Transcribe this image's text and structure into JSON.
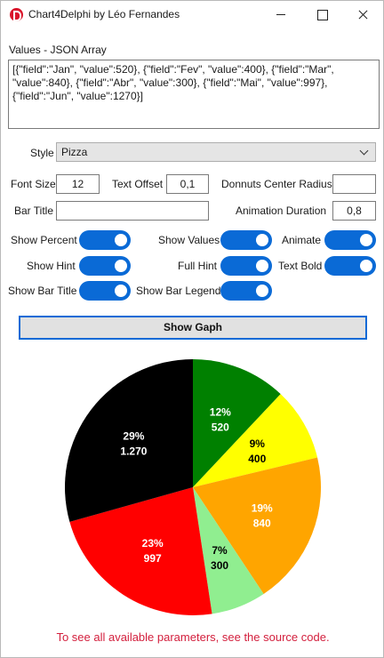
{
  "window": {
    "title": "Chart4Delphi by Léo Fernandes"
  },
  "values_label": "Values - JSON Array",
  "json_text": "[{\"field\":\"Jan\", \"value\":520}, {\"field\":\"Fev\", \"value\":400}, {\"field\":\"Mar\", \"value\":840}, {\"field\":\"Abr\", \"value\":300}, {\"field\":\"Mai\", \"value\":997}, {\"field\":\"Jun\", \"value\":1270}]",
  "style": {
    "label": "Style",
    "value": "Pizza"
  },
  "font_size": {
    "label": "Font Size",
    "value": "12"
  },
  "text_offset": {
    "label": "Text Offset",
    "value": "0,1"
  },
  "donut_radius": {
    "label": "Donnuts Center Radius",
    "value": ""
  },
  "bar_title": {
    "label": "Bar Title",
    "value": ""
  },
  "animation_duration": {
    "label": "Animation Duration",
    "value": "0,8"
  },
  "toggles": {
    "show_percent": "Show Percent",
    "show_values": "Show Values",
    "animate": "Animate",
    "show_hint": "Show Hint",
    "full_hint": "Full Hint",
    "text_bold": "Text Bold",
    "show_bar_title": "Show Bar Title",
    "show_bar_legend": "Show Bar Legend"
  },
  "show_button": "Show Gaph",
  "footer": "To see all available parameters, see the source code.",
  "chart_data": {
    "type": "pie",
    "slices": [
      {
        "field": "Jan",
        "value": 520,
        "percent": "12%",
        "value_label": "520",
        "color": "#008000",
        "label_color": "#ffffff"
      },
      {
        "field": "Fev",
        "value": 400,
        "percent": "9%",
        "value_label": "400",
        "color": "#ffff00",
        "label_color": "#000000"
      },
      {
        "field": "Mar",
        "value": 840,
        "percent": "19%",
        "value_label": "840",
        "color": "#ffa500",
        "label_color": "#ffffff"
      },
      {
        "field": "Abr",
        "value": 300,
        "percent": "7%",
        "value_label": "300",
        "color": "#90ee90",
        "label_color": "#000000"
      },
      {
        "field": "Mai",
        "value": 997,
        "percent": "23%",
        "value_label": "997",
        "color": "#ff0000",
        "label_color": "#ffffff"
      },
      {
        "field": "Jun",
        "value": 1270,
        "percent": "29%",
        "value_label": "1.270",
        "color": "#000000",
        "label_color": "#ffffff"
      }
    ]
  }
}
